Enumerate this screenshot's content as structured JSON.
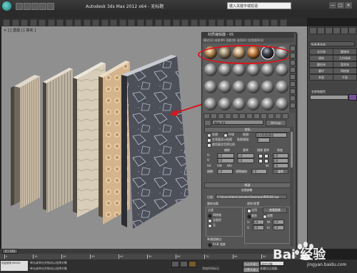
{
  "window": {
    "title": "Autodesk 3ds Max 2012 x64 - 无标题",
    "search_placeholder": "键入关键字或短语",
    "buttons": [
      "—",
      "□",
      "✕"
    ]
  },
  "viewport": {
    "label": "+ ] [ 透视 ] [ 真实 ]"
  },
  "material_editor": {
    "title": "材质编辑器 - 05",
    "menu": "模式(D)  材质(M)  导航(N)  选项(O)  实用程序(U)",
    "material_name": "Map #4",
    "material_type": "Bitmap",
    "rollout_coords": "坐标",
    "coords": {
      "texture_label": "纹理",
      "environ_label": "环境",
      "mapping_label": "贴图:",
      "mapping_value": "显式贴图通道",
      "show_map_back": "在背面显示贴图",
      "map_channel_label": "贴图通道:",
      "map_channel_value": "1",
      "real_world": "使用真实世界比例",
      "offset_label": "偏移",
      "tiling_label": "瓷砖",
      "mirror_label": "镜像 瓷砖",
      "angle_label": "角度",
      "u_offset": "0.0",
      "v_offset": "0.0",
      "u_tiling": "1.0",
      "v_tiling": "1.0",
      "u_angle": "0.0",
      "v_angle": "0.0",
      "w_angle": "0.0",
      "uv_label": "UV",
      "vw_label": "VW",
      "wu_label": "WU",
      "blur_label": "模糊:",
      "blur_value": "1.0",
      "blur_offset_label": "模糊偏移:",
      "blur_offset_value": "0.0",
      "rotate_label": "旋转"
    },
    "rollout_noise": "噪波",
    "rollout_bitmap": "位图参数",
    "bitmap": {
      "bitmap_label": "位图:",
      "bitmap_path": "C:\\Users\\Administrator\\Desktop\\墙面\\06.jpg",
      "reload_label": "重新加载",
      "crop_label": "裁剪/放置",
      "filter_label": "过滤",
      "apply_label": "应用",
      "view_image_label": "查看图像",
      "filter_opts": [
        "四棱锥",
        "总面积",
        "无"
      ],
      "crop_opts": [
        "裁剪",
        "放置"
      ],
      "u_label": "U:",
      "v_label": "V:",
      "w_label": "W:",
      "h_label": "H:",
      "u_val": "0.0",
      "v_val": "0.0",
      "w_val": "1.0",
      "h_val": "1.0",
      "mono_label": "单通道输出:",
      "rgb_label": "RGB 强度"
    }
  },
  "command_panel": {
    "dropdown": "标准基本体",
    "buttons": [
      "长方体",
      "圆锥体",
      "球体",
      "几何球体",
      "圆柱体",
      "管状体",
      "圆环",
      "四棱锥",
      "茶壶",
      "平面"
    ],
    "name_label": "名称和颜色"
  },
  "timeline": {
    "frame": "0 / 100",
    "ticks": [
      "0",
      "10",
      "20",
      "30",
      "40",
      "50",
      "60",
      "70",
      "80",
      "90",
      "100"
    ]
  },
  "status": {
    "maxscript": "欢迎使用 MAXSc",
    "line1": "单击或单击并拖动以选择对象",
    "line2": "单击或单击并拖动以选择对象",
    "add_time_tag": "添加时间标记",
    "auto_key": "自动关键点",
    "selection": "选定对象",
    "set_key": "设置关键点",
    "key_filter": "关键点过滤器..."
  },
  "watermark": {
    "text": "Bai 经验",
    "sub": "jingyan.baidu.com"
  },
  "colors": {
    "highlight_ellipse": "#d8151b",
    "arrow": "#d8151b"
  }
}
